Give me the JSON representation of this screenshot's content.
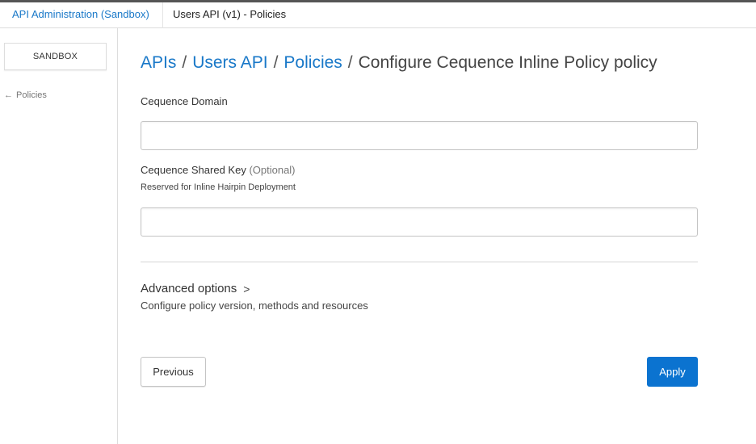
{
  "header": {
    "app_breadcrumb": "API Administration (Sandbox)",
    "page_breadcrumb": "Users API (v1) - Policies"
  },
  "sidebar": {
    "environment_button": "SANDBOX",
    "back_link_label": "Policies",
    "back_link_icon": "arrow-left-icon"
  },
  "main": {
    "title": {
      "crumb_apis": "APIs",
      "crumb_api": "Users API",
      "crumb_policies": "Policies",
      "separator": "/",
      "current": "Configure Cequence Inline Policy policy"
    },
    "fields": {
      "domain": {
        "label": "Cequence Domain",
        "value": "",
        "placeholder": ""
      },
      "shared_key": {
        "label": "Cequence Shared Key",
        "optional_label": "(Optional)",
        "hint": "Reserved for Inline Hairpin Deployment",
        "value": "",
        "placeholder": ""
      }
    },
    "advanced": {
      "label": "Advanced options",
      "chevron": ">",
      "description": "Configure policy version, methods and resources"
    },
    "buttons": {
      "previous": "Previous",
      "apply": "Apply"
    }
  },
  "colors": {
    "link": "#1978c8",
    "primary_button": "#0b73d0"
  }
}
